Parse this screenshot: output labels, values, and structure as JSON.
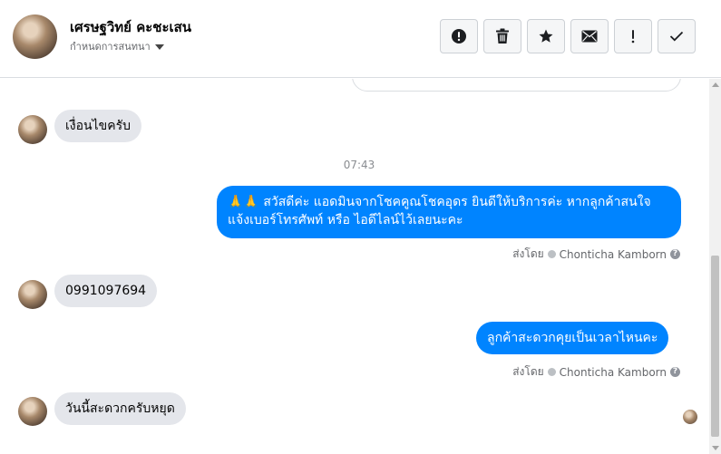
{
  "header": {
    "contact_name": "เศรษฐวิทย์ คะชะเสน",
    "contact_subtitle": "กำหนดการสนทนา"
  },
  "toolbar": {
    "buttons": [
      {
        "name": "report",
        "icon": "exclamation-circle-icon"
      },
      {
        "name": "delete",
        "icon": "trash-icon"
      },
      {
        "name": "star",
        "icon": "star-icon"
      },
      {
        "name": "mark-unread",
        "icon": "envelope-icon"
      },
      {
        "name": "important",
        "icon": "exclamation-icon"
      },
      {
        "name": "done",
        "icon": "checkmark-icon"
      }
    ]
  },
  "messages": [
    {
      "direction": "in",
      "text": "เงื่อนไขครับ"
    },
    {
      "timestamp": "07:43"
    },
    {
      "direction": "out",
      "lines": [
        "🙏🙏 สวัสดีค่ะ แอดมินจากโชคคูณโชคอุดร ยินดีให้บริการค่ะ หากลูกค้าสนใจ",
        "แจ้งเบอร์โทรศัพท์ หรือ ไอดีไลน์ไว้เลยนะคะ"
      ],
      "sent_by_label": "ส่งโดย",
      "sent_by_name": "Chonticha Kamborn"
    },
    {
      "direction": "in",
      "text": "0991097694"
    },
    {
      "direction": "out",
      "text": "ลูกค้าสะดวกคุยเป็นเวลาไหนคะ",
      "sent_by_label": "ส่งโดย",
      "sent_by_name": "Chonticha Kamborn"
    },
    {
      "direction": "in",
      "text": "วันนี้สะดวกครับหยุด"
    }
  ],
  "colors": {
    "outgoing_bubble": "#0084ff",
    "incoming_bubble": "#e4e6eb",
    "meta_text": "#65676b"
  }
}
